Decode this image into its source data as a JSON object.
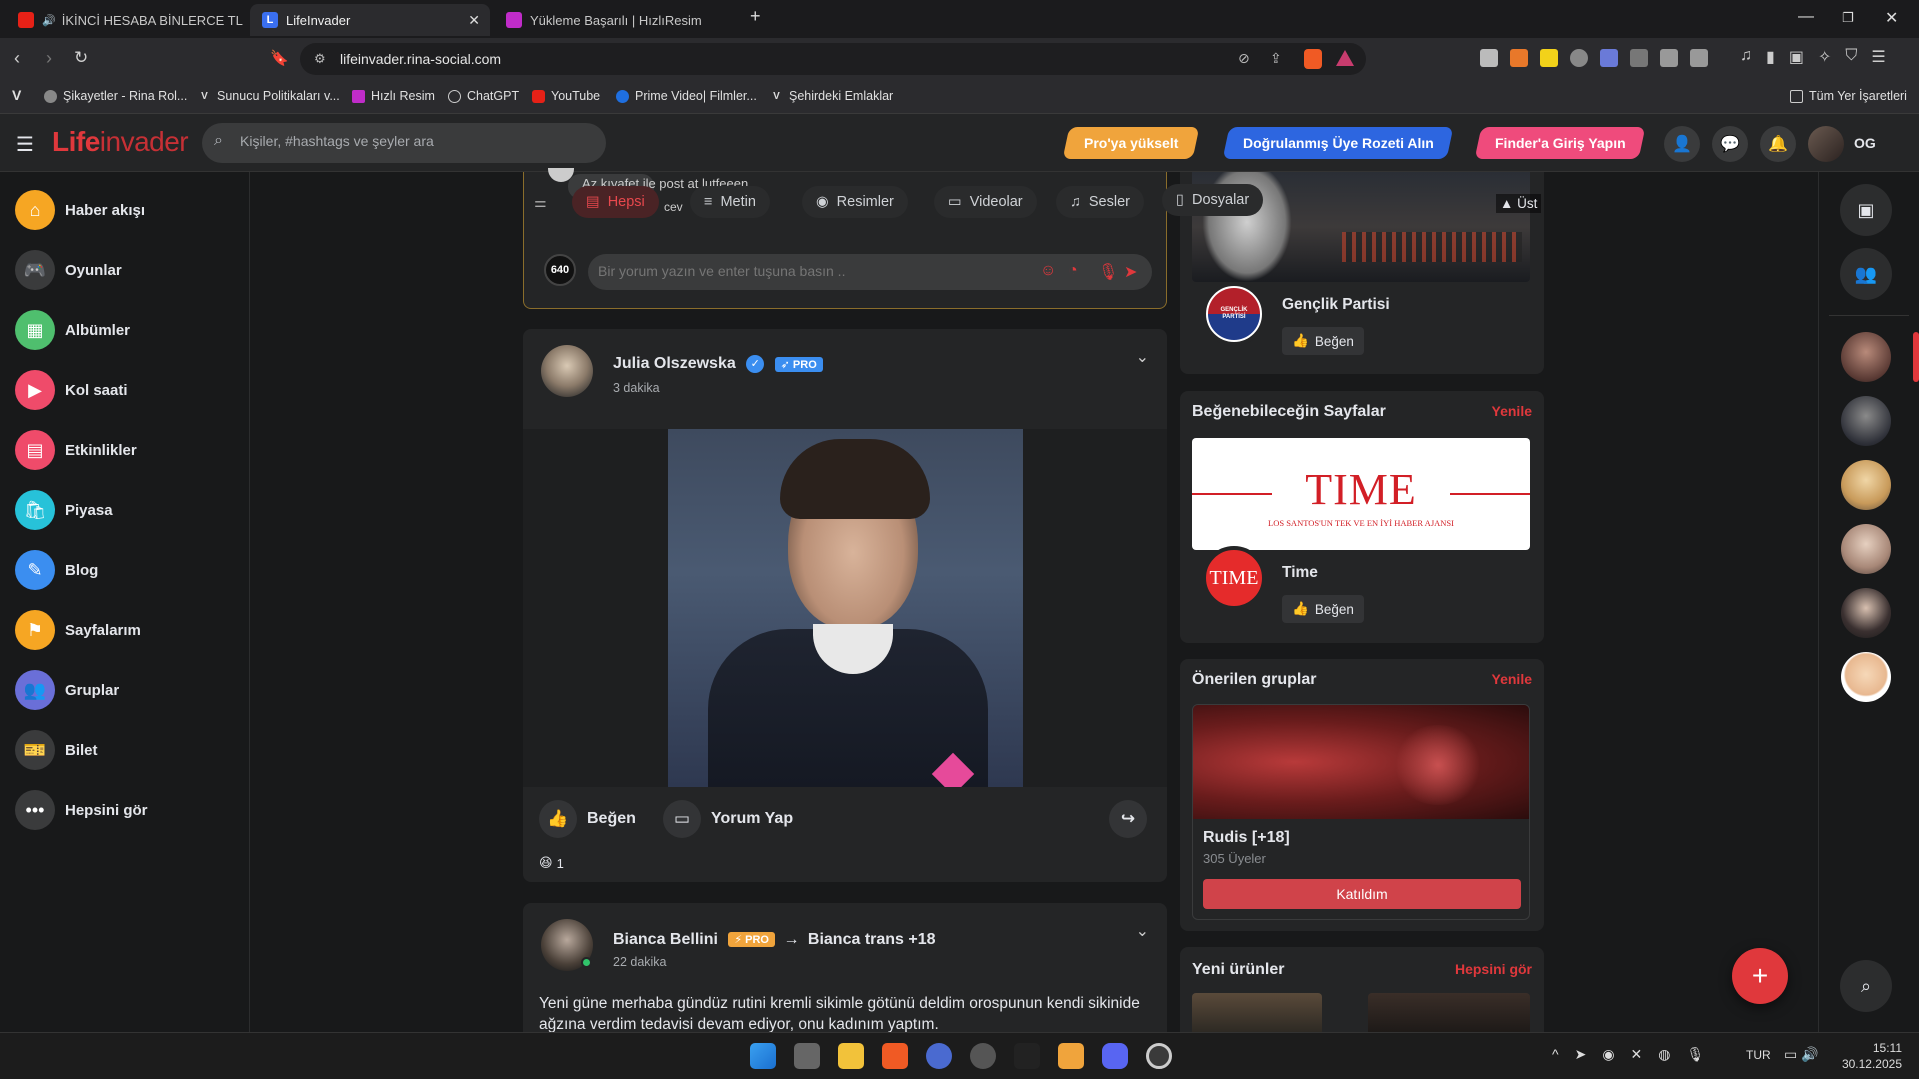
{
  "browser": {
    "tabs": [
      {
        "label": "İKİNCİ HESABA BİNLERCE TL DEĞ",
        "active": false
      },
      {
        "label": "LifeInvader",
        "active": true
      },
      {
        "label": "Yükleme Başarılı | HızlıResim",
        "active": false
      }
    ],
    "url": "lifeinvader.rina-social.com",
    "bookmarks": [
      "Şikayetler - Rina Rol...",
      "Sunucu Politikaları v...",
      "Hızlı Resim",
      "ChatGPT",
      "YouTube",
      "Prime Video| Filmler...",
      "Şehirdeki Emlaklar"
    ],
    "all_bookmarks": "Tüm Yer İşaretleri"
  },
  "header": {
    "logo_a": "Life",
    "logo_b": "invader",
    "search_placeholder": "Kişiler, #hashtags ve şeyler ara",
    "btn_pro": "Pro'ya yükselt",
    "btn_verified": "Doğrulanmış Üye Rozeti Alın",
    "btn_finder": "Finder'a Giriş Yapın",
    "user_initials": "OG",
    "colors": {
      "accent": "#e0383c",
      "pro": "#f0a43c",
      "verified": "#2d66e0",
      "finder": "#ef4b7c"
    }
  },
  "sidebar": {
    "items": [
      {
        "label": "Haber akışı",
        "icon": "home-icon",
        "color": "#f6a623"
      },
      {
        "label": "Oyunlar",
        "icon": "gamepad-icon",
        "color": "#3a3b3c"
      },
      {
        "label": "Albümler",
        "icon": "album-icon",
        "color": "#4fbf6e"
      },
      {
        "label": "Kol saati",
        "icon": "watch-icon",
        "color": "#ef4b6a"
      },
      {
        "label": "Etkinlikler",
        "icon": "calendar-icon",
        "color": "#ef4b6a"
      },
      {
        "label": "Piyasa",
        "icon": "market-icon",
        "color": "#27c2d9"
      },
      {
        "label": "Blog",
        "icon": "blog-icon",
        "color": "#3b8ef0"
      },
      {
        "label": "Sayfalarım",
        "icon": "flag-icon",
        "color": "#f6a623"
      },
      {
        "label": "Gruplar",
        "icon": "group-icon",
        "color": "#6a6fd8"
      },
      {
        "label": "Bilet",
        "icon": "ticket-icon",
        "color": "#3a3b3c"
      },
      {
        "label": "Hepsini gör",
        "icon": "more-icon",
        "color": "#3a3b3c"
      }
    ]
  },
  "composer": {
    "partial_text": "Az kıyafet ile post at lutfeeen",
    "partial_text_2": "cev",
    "filters": [
      "Hepsi",
      "Metin",
      "Resimler",
      "Videolar",
      "Sesler",
      "Dosyalar"
    ],
    "top_link": "Üst",
    "comment_count": "640",
    "comment_placeholder": "Bir yorum yazın ve enter tuşuna basın .."
  },
  "post1": {
    "author": "Julia Olszewska",
    "badge": "PRO",
    "time": "3 dakika",
    "like": "Beğen",
    "comment": "Yorum Yap",
    "reaction_count": "1"
  },
  "post2": {
    "author": "Bianca Bellini",
    "badge": "PRO",
    "arrow": "→",
    "target": "Bianca trans +18",
    "time": "22 dakika",
    "text": "Yeni güne merhaba gündüz rutini kremli sikimle götünü deldim orospunun kendi sikinide ağzına verdim tedavisi devam ediyor, onu kadınım yaptım."
  },
  "right": {
    "page1_name": "Gençlik Partisi",
    "page1_logo_text": "GENÇLİK PARTİSİ",
    "like": "Beğen",
    "suggested_title": "Beğenebileceğin Sayfalar",
    "refresh": "Yenile",
    "time_banner_title": "TIME",
    "time_banner_sub": "LOS SANTOS'UN TEK VE EN İYİ HABER AJANSI",
    "time_logo": "TIME",
    "time_name": "Time",
    "groups_title": "Önerilen gruplar",
    "group_name": "Rudis [+18]",
    "group_members": "305 Üyeler",
    "joined": "Katıldım",
    "products_title": "Yeni ürünler",
    "see_all": "Hepsini gör"
  },
  "taskbar": {
    "lang": "TUR",
    "time": "15:11",
    "date": "30.12.2025"
  }
}
